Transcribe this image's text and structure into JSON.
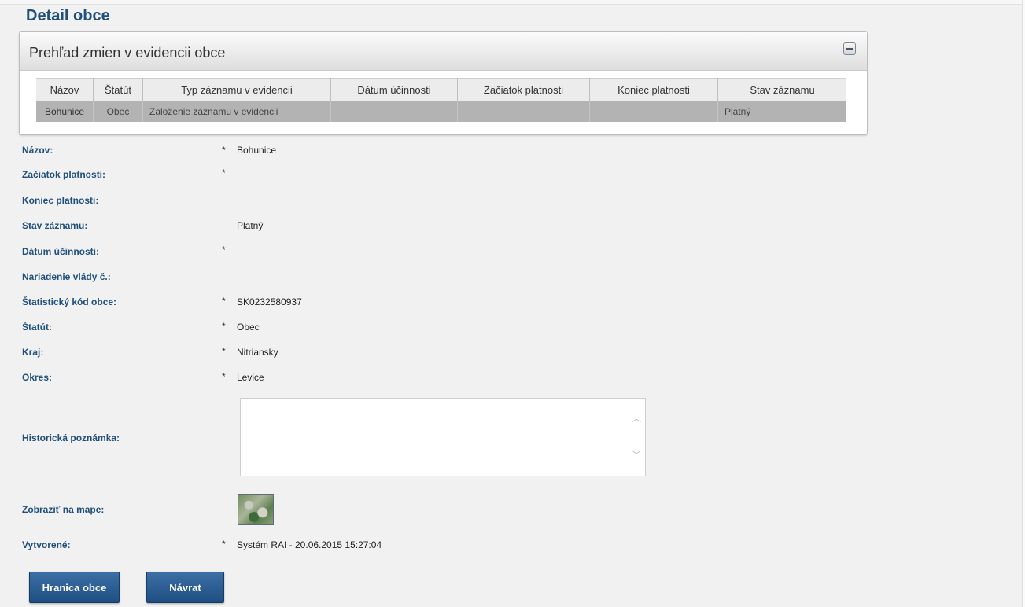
{
  "page_title": "Detail obce",
  "panel": {
    "title": "Prehľad zmien v evidencii obce",
    "columns": [
      "Názov",
      "Štatút",
      "Typ záznamu v evidencii",
      "Dátum účinnosti",
      "Začiatok platnosti",
      "Koniec platnosti",
      "Stav záznamu"
    ],
    "rows": [
      [
        "Bohunice",
        "Obec",
        "Založenie záznamu v evidencii",
        "",
        "",
        "",
        "Platný"
      ]
    ]
  },
  "fields": {
    "nazov": {
      "label": "Názov:",
      "star": "*",
      "value": "Bohunice"
    },
    "zaciatok": {
      "label": "Začiatok platnosti:",
      "star": "*",
      "value": ""
    },
    "koniec": {
      "label": "Koniec platnosti:",
      "star": "",
      "value": ""
    },
    "stav": {
      "label": "Stav záznamu:",
      "star": "",
      "value": "Platný"
    },
    "datum": {
      "label": "Dátum účinnosti:",
      "star": "*",
      "value": ""
    },
    "nariadenie": {
      "label": "Nariadenie vlády č.:",
      "star": "",
      "value": ""
    },
    "kod": {
      "label": "Štatistický kód obce:",
      "star": "*",
      "value": "SK0232580937"
    },
    "statut": {
      "label": "Štatút:",
      "star": "*",
      "value": "Obec"
    },
    "kraj": {
      "label": "Kraj:",
      "star": "*",
      "value": "Nitriansky"
    },
    "okres": {
      "label": "Okres:",
      "star": "*",
      "value": "Levice"
    },
    "poznamka": {
      "label": "Historická poznámka:",
      "value": ""
    },
    "mapa": {
      "label": "Zobraziť na mape:"
    },
    "vytvorene": {
      "label": "Vytvorené:",
      "star": "*",
      "value": "Systém RAI - 20.06.2015 15:27:04"
    }
  },
  "buttons": {
    "hranica": "Hranica obce",
    "navrat": "Návrat"
  }
}
